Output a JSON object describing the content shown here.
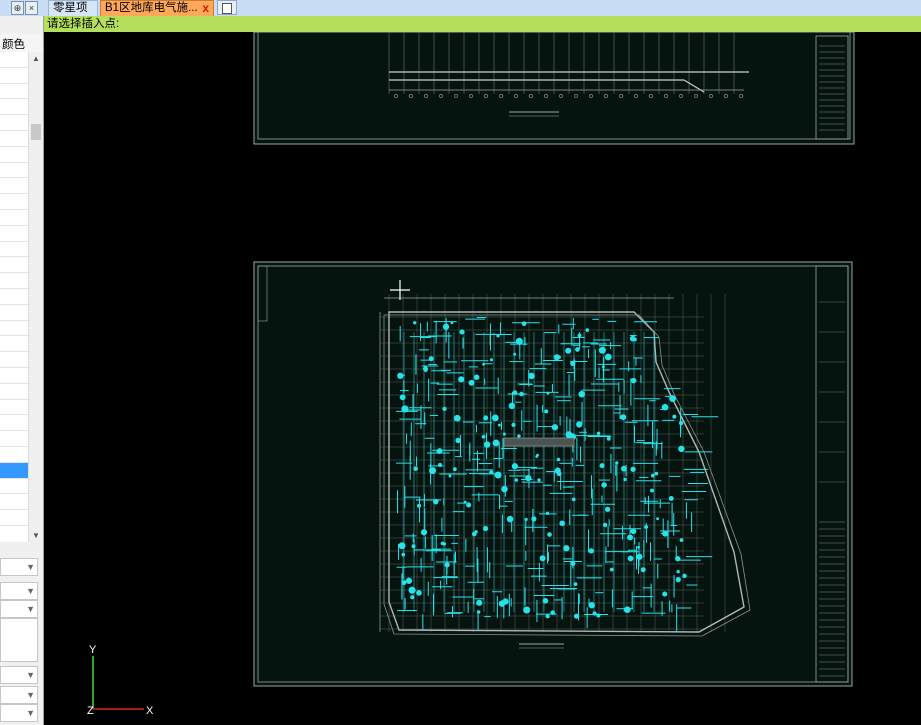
{
  "tabs": [
    {
      "label": "零星项目"
    },
    {
      "label": "B1区地库电气施..."
    }
  ],
  "tab_close_glyph": "x",
  "command_prompt": "请选择插入点:",
  "left_panel": {
    "column_header": "颜色",
    "rows": 30,
    "selected_row": 26
  },
  "ucs": {
    "y_label": "Y",
    "x_label": "X",
    "z_label": "Z"
  },
  "colors": {
    "drawing_bg": "#061410",
    "frame": "#9aa6a0",
    "wiring": "#26e3ea",
    "cmd_bar": "#b4df5a",
    "active_tab": "#ffa85a"
  }
}
